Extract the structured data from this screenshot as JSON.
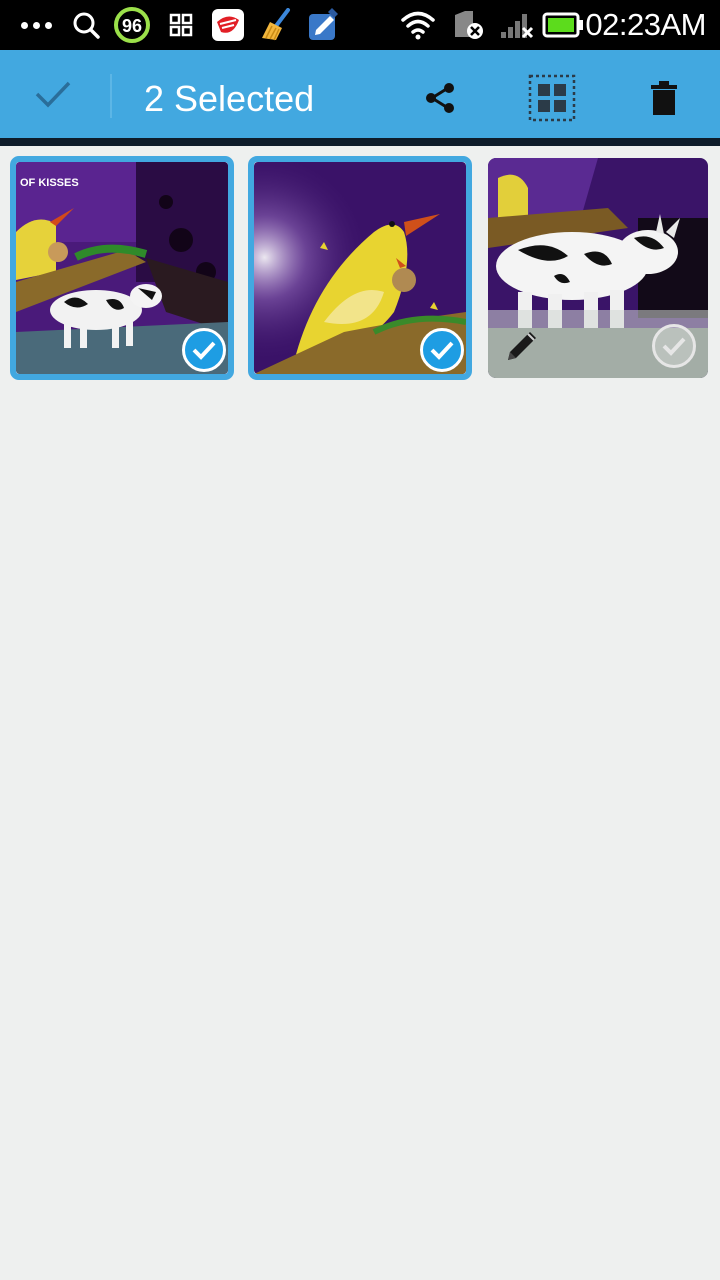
{
  "status_bar": {
    "time": "02:23AM",
    "battery_badge": "96",
    "icons": [
      "more-dots-icon",
      "search-icon",
      "battery-saver-96-icon",
      "qr-apps-icon",
      "mail-app-icon",
      "cleaner-broom-icon",
      "file-manager-icon",
      "wifi-icon",
      "sim-disabled-icon",
      "signal-no-service-icon",
      "battery-icon"
    ]
  },
  "action_bar": {
    "title": "2 Selected",
    "actions": [
      "done-check-icon",
      "share-icon",
      "select-all-icon",
      "delete-trash-icon"
    ],
    "color": "#42a8e0"
  },
  "gallery": {
    "items": [
      {
        "subject": "duck-and-cow-toy-photo",
        "selected": true,
        "overlay_icon": "check-circle-icon",
        "caption_in_photo": "OF KISSES"
      },
      {
        "subject": "yellow-duck-painting-photo",
        "selected": true,
        "overlay_icon": "check-circle-icon"
      },
      {
        "subject": "cow-toy-closeup-photo",
        "selected": false,
        "overlay_icon": "check-circle-icon",
        "edit_icon": "pencil-icon"
      }
    ],
    "selected_color": "#42a8e0",
    "background": "#eef0ef"
  }
}
